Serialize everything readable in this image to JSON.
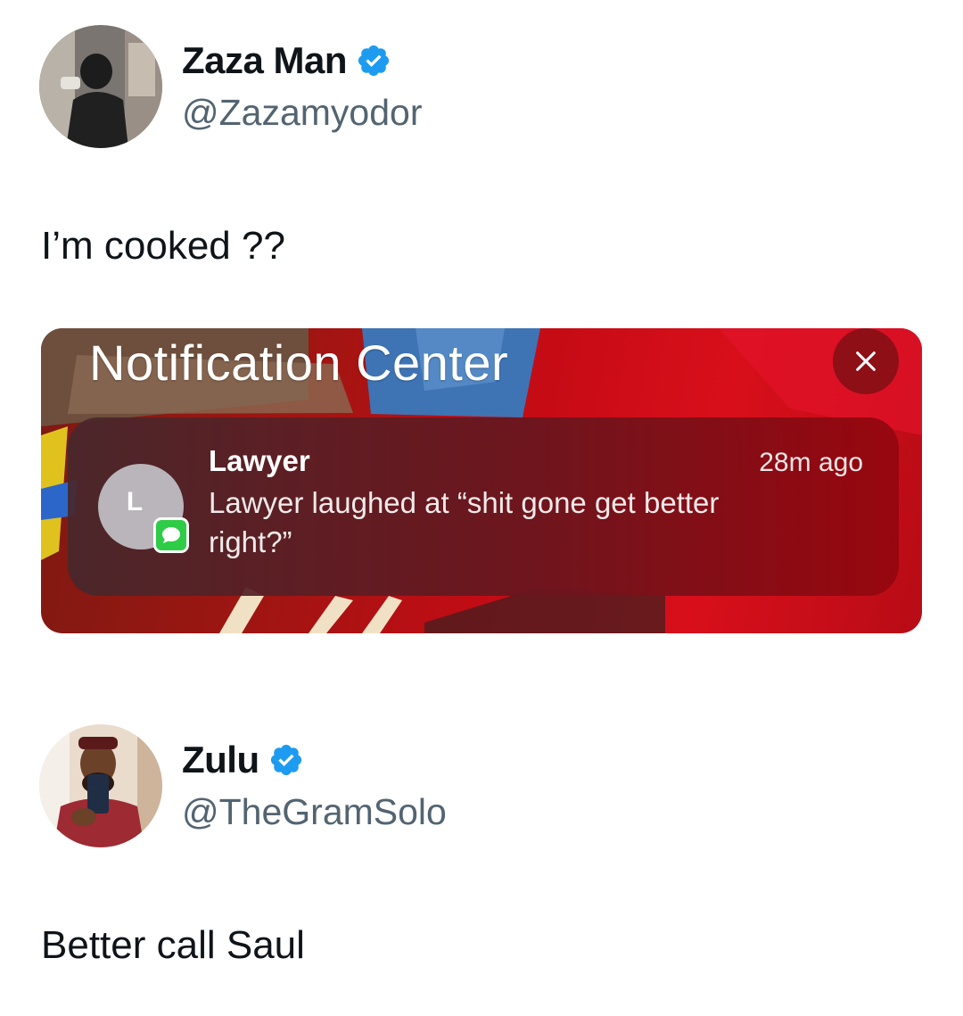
{
  "tweets": [
    {
      "display_name": "Zaza Man",
      "handle": "@Zazamyodor",
      "text": "I’m cooked ??",
      "avatar_icon": "user-avatar-photo",
      "verified_icon": "verified-badge-icon"
    },
    {
      "display_name": "Zulu",
      "handle": "@TheGramSolo",
      "text": "Better call Saul",
      "avatar_icon": "user-avatar-photo",
      "verified_icon": "verified-badge-icon"
    }
  ],
  "notification_center": {
    "title": "Notification Center",
    "close_icon": "close-icon",
    "notification": {
      "avatar_letter": "L",
      "app_icon": "messages-icon",
      "sender": "Lawyer",
      "message": "Lawyer laughed at “shit gone get better right?”",
      "time": "28m ago"
    }
  },
  "colors": {
    "verified_blue": "#1d9bf0",
    "handle_gray": "#536471",
    "messages_green": "#2fcc47",
    "card_red": "#c60b15"
  }
}
